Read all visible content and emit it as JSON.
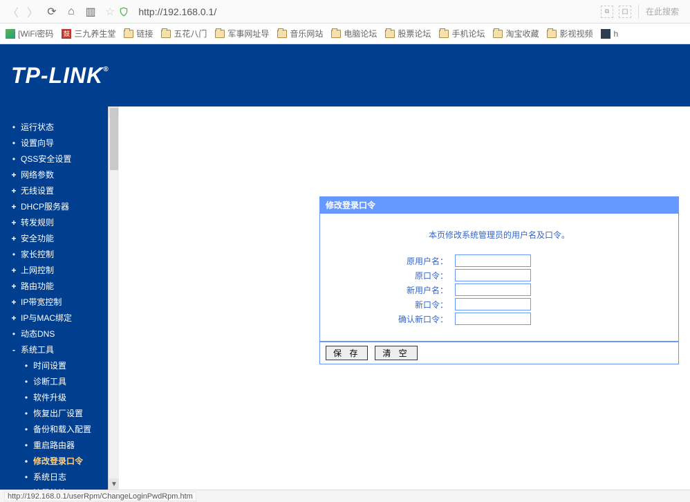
{
  "browser": {
    "url": "http://192.168.0.1/",
    "search_placeholder": "在此搜索"
  },
  "bookmarks": [
    {
      "label": "[WiFi密码",
      "icon": "green"
    },
    {
      "label": "三九养生堂",
      "icon": "red",
      "badge": "鼓"
    },
    {
      "label": "链接",
      "icon": "folder"
    },
    {
      "label": "五花八门",
      "icon": "folder"
    },
    {
      "label": "军事网址导",
      "icon": "folder"
    },
    {
      "label": "音乐网站",
      "icon": "folder"
    },
    {
      "label": "电脑论坛",
      "icon": "folder"
    },
    {
      "label": "股票论坛",
      "icon": "folder"
    },
    {
      "label": "手机论坛",
      "icon": "folder"
    },
    {
      "label": "淘宝收藏",
      "icon": "folder"
    },
    {
      "label": "影视视频",
      "icon": "folder"
    },
    {
      "label": "h",
      "icon": "blue"
    }
  ],
  "logo": "TP-LINK",
  "sidebar": {
    "items": [
      {
        "type": "dot",
        "label": "运行状态"
      },
      {
        "type": "dot",
        "label": "设置向导"
      },
      {
        "type": "dot",
        "label": "QSS安全设置"
      },
      {
        "type": "plus",
        "label": "网络参数"
      },
      {
        "type": "plus",
        "label": "无线设置"
      },
      {
        "type": "plus",
        "label": "DHCP服务器"
      },
      {
        "type": "plus",
        "label": "转发规则"
      },
      {
        "type": "plus",
        "label": "安全功能"
      },
      {
        "type": "dot",
        "label": "家长控制"
      },
      {
        "type": "plus",
        "label": "上网控制"
      },
      {
        "type": "plus",
        "label": "路由功能"
      },
      {
        "type": "plus",
        "label": "IP带宽控制"
      },
      {
        "type": "plus",
        "label": "IP与MAC绑定"
      },
      {
        "type": "dot",
        "label": "动态DNS"
      },
      {
        "type": "minus",
        "label": "系统工具"
      }
    ],
    "subitems": [
      {
        "label": "时间设置"
      },
      {
        "label": "诊断工具"
      },
      {
        "label": "软件升级"
      },
      {
        "label": "恢复出厂设置"
      },
      {
        "label": "备份和载入配置"
      },
      {
        "label": "重启路由器"
      },
      {
        "label": "修改登录口令",
        "active": true
      },
      {
        "label": "系统日志"
      },
      {
        "label": "流量统计"
      }
    ]
  },
  "panel": {
    "title": "修改登录口令",
    "desc": "本页修改系统管理员的用户名及口令。",
    "fields": {
      "old_user": "原用户名：",
      "old_pwd": "原口令：",
      "new_user": "新用户名：",
      "new_pwd": "新口令：",
      "confirm_pwd": "确认新口令："
    },
    "buttons": {
      "save": "保 存",
      "clear": "清 空"
    }
  },
  "status": "http://192.168.0.1/userRpm/ChangeLoginPwdRpm.htm"
}
